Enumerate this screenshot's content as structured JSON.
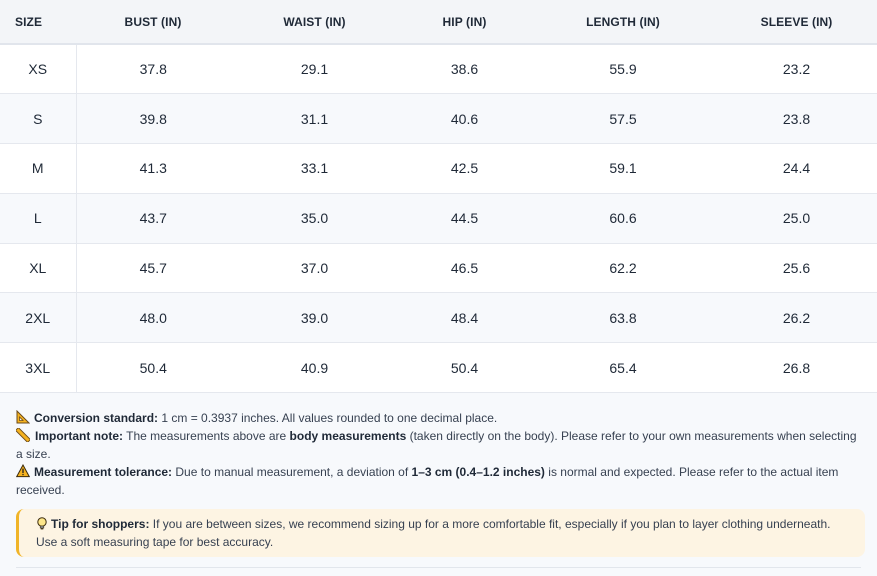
{
  "table": {
    "headers": [
      "SIZE",
      "BUST (IN)",
      "WAIST (IN)",
      "HIP (IN)",
      "LENGTH (IN)",
      "SLEEVE (IN)"
    ],
    "rows": [
      [
        "XS",
        "37.8",
        "29.1",
        "38.6",
        "55.9",
        "23.2"
      ],
      [
        "S",
        "39.8",
        "31.1",
        "40.6",
        "57.5",
        "23.8"
      ],
      [
        "M",
        "41.3",
        "33.1",
        "42.5",
        "59.1",
        "24.4"
      ],
      [
        "L",
        "43.7",
        "35.0",
        "44.5",
        "60.6",
        "25.0"
      ],
      [
        "XL",
        "45.7",
        "37.0",
        "46.5",
        "62.2",
        "25.6"
      ],
      [
        "2XL",
        "48.0",
        "39.0",
        "48.4",
        "63.8",
        "26.2"
      ],
      [
        "3XL",
        "50.4",
        "40.9",
        "50.4",
        "65.4",
        "26.8"
      ]
    ]
  },
  "notes": {
    "conversion": {
      "icon": "ruler-triangle-icon",
      "label": "Conversion standard:",
      "text": " 1 cm = 0.3937 inches. All values rounded to one decimal place."
    },
    "important": {
      "icon": "ruler-icon",
      "label": "Important note:",
      "text_before": " The measurements above are ",
      "emphasis": "body measurements",
      "text_after": " (taken directly on the body). Please refer to your own measurements when selecting a size."
    },
    "tolerance": {
      "icon": "warning-icon",
      "label": "Measurement tolerance:",
      "text_before": " Due to manual measurement, a deviation of ",
      "emphasis": "1–3 cm (0.4–1.2 inches)",
      "text_after": " is normal and expected. Please refer to the actual item received."
    }
  },
  "tip": {
    "icon": "lightbulb-icon",
    "label": "Tip for shoppers:",
    "text": " If you are between sizes, we recommend sizing up for a more comfortable fit, especially if you plan to layer clothing underneath. Use a soft measuring tape for best accuracy."
  },
  "colors": {
    "header_bg": "#f3f5f8",
    "row_alt_bg": "#f7f9fc",
    "border": "#e5e8ee",
    "tip_bg": "#fdf4e3",
    "tip_accent": "#f0b429",
    "ruler_yellow": "#f5b21f",
    "ruler_dark": "#6b4b1b"
  }
}
